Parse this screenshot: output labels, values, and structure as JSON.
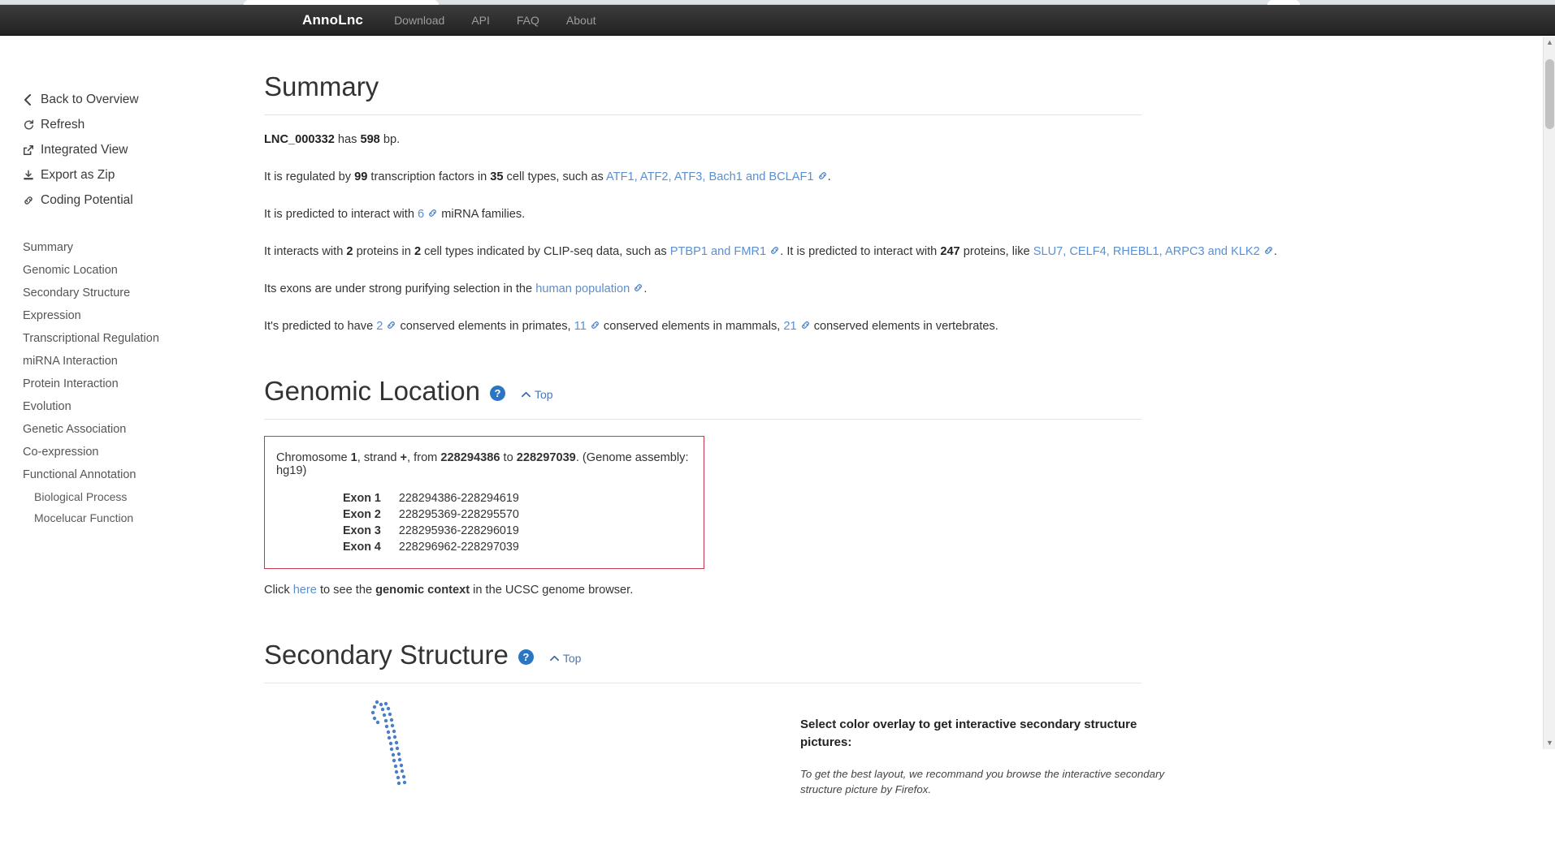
{
  "navbar": {
    "brand": "AnnoLnc",
    "links": [
      {
        "label": "Download",
        "name": "nav-download"
      },
      {
        "label": "API",
        "name": "nav-api"
      },
      {
        "label": "FAQ",
        "name": "nav-faq"
      },
      {
        "label": "About",
        "name": "nav-about"
      }
    ]
  },
  "sidebar": {
    "actions": [
      {
        "label": "Back to Overview",
        "icon": "chevron-left-icon",
        "glyph": "❮"
      },
      {
        "label": "Refresh",
        "icon": "refresh-icon",
        "glyph": "↻"
      },
      {
        "label": "Integrated View",
        "icon": "external-link-icon",
        "glyph": "↗"
      },
      {
        "label": "Export as Zip",
        "icon": "download-archive-icon",
        "glyph": "↧"
      },
      {
        "label": "Coding Potential",
        "icon": "link-chain-icon",
        "glyph": "🔗"
      }
    ],
    "toc": [
      {
        "label": "Summary",
        "sub": false
      },
      {
        "label": "Genomic Location",
        "sub": false
      },
      {
        "label": "Secondary Structure",
        "sub": false
      },
      {
        "label": "Expression",
        "sub": false
      },
      {
        "label": "Transcriptional Regulation",
        "sub": false
      },
      {
        "label": "miRNA Interaction",
        "sub": false
      },
      {
        "label": "Protein Interaction",
        "sub": false
      },
      {
        "label": "Evolution",
        "sub": false
      },
      {
        "label": "Genetic Association",
        "sub": false
      },
      {
        "label": "Co-expression",
        "sub": false
      },
      {
        "label": "Functional Annotation",
        "sub": false
      },
      {
        "label": "Biological Process",
        "sub": true
      },
      {
        "label": "Mocelucar Function",
        "sub": true
      }
    ]
  },
  "summary": {
    "heading": "Summary",
    "lnc_id": "LNC_000332",
    "length_text_pre": " has ",
    "length": "598",
    "length_unit": " bp.",
    "line_tf": {
      "pre": "It is regulated by ",
      "tf_count": "99",
      "mid1": " transcription factors in ",
      "cell_types": "35",
      "mid2": " cell types, such as ",
      "examples": "ATF1, ATF2, ATF3, Bach1 and BCLAF1",
      "post": "."
    },
    "line_mirna": {
      "pre": "It is predicted to interact with ",
      "count": "6",
      "post": " miRNA families."
    },
    "line_protein": {
      "pre": "It interacts with ",
      "proteins": "2",
      "mid1": " proteins in ",
      "cell_types": "2",
      "mid2": " cell types indicated by CLIP-seq data, such as ",
      "examples1": "PTBP1 and FMR1",
      "mid3": ". It is predicted to interact with ",
      "pred_count": "247",
      "mid4": " proteins, like ",
      "examples2": "SLU7, CELF4, RHEBL1, ARPC3 and KLK2",
      "post": "."
    },
    "line_selection": {
      "pre": "Its exons are under strong purifying selection in the ",
      "link": "human population",
      "post": "."
    },
    "line_conserved": {
      "pre": "It's predicted to have ",
      "primates": "2",
      "mid1": " conserved elements in primates, ",
      "mammals": "11",
      "mid2": " conserved elements in mammals, ",
      "vertebrates": "21",
      "post": " conserved elements in vertebrates."
    }
  },
  "genomic_location": {
    "heading": "Genomic Location",
    "help_glyph": "?",
    "top_label": "Top",
    "header_pre": "Chromosome ",
    "chromosome": "1",
    "header_mid1": ", strand ",
    "strand": "+",
    "header_mid2": ", from ",
    "start": "228294386",
    "header_mid3": " to ",
    "end": "228297039",
    "assembly_text": ". (Genome assembly: hg19)",
    "exons": [
      {
        "name": "Exon 1",
        "range": "228294386-228294619"
      },
      {
        "name": "Exon 2",
        "range": "228295369-228295570"
      },
      {
        "name": "Exon 3",
        "range": "228295936-228296019"
      },
      {
        "name": "Exon 4",
        "range": "228296962-228297039"
      }
    ],
    "footer_pre": "Click ",
    "footer_link": "here",
    "footer_mid": " to see the ",
    "footer_bold": "genomic context",
    "footer_post": " in the UCSC genome browser."
  },
  "secondary_structure": {
    "heading": "Secondary Structure",
    "help_glyph": "?",
    "top_label": "Top",
    "overlay_title": "Select color overlay to get interactive secondary structure pictures:",
    "overlay_note": "To get the best layout, we recommand you browse the interactive secondary structure picture by Firefox."
  },
  "colors": {
    "navbar_bg": "#222222",
    "brand": "#ffffff",
    "nav_link": "#9d9d9d",
    "link": "#5b8fd0",
    "help_badge": "#2b76c4",
    "box_border": "#c4384e",
    "rna_dot": "#4a7ec8",
    "text": "#333333"
  },
  "scrollbar": {
    "up_glyph": "▲",
    "down_glyph": "▼"
  }
}
